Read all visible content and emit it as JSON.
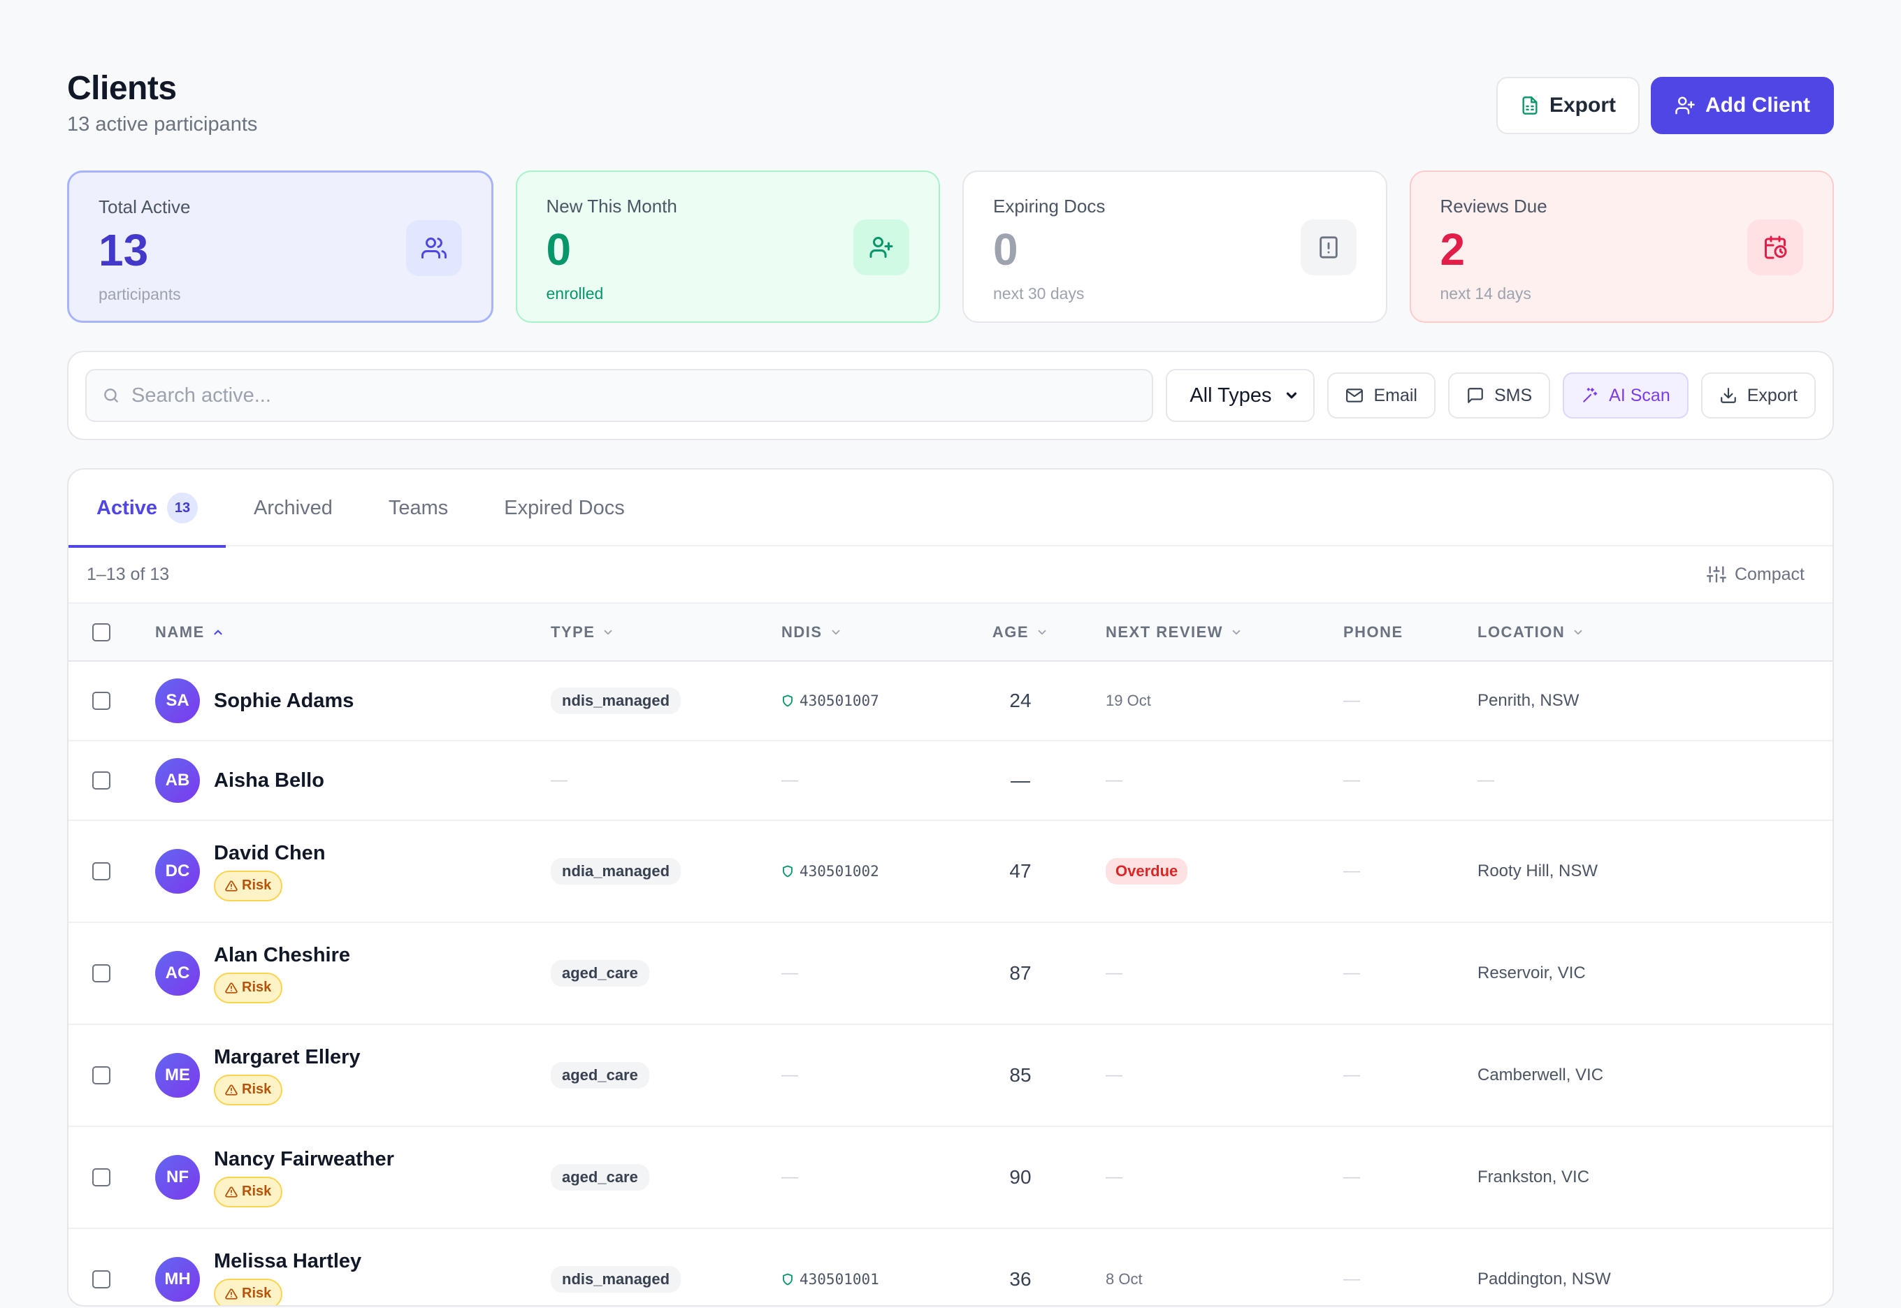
{
  "header": {
    "title": "Clients",
    "subtitle": "13 active participants",
    "export_label": "Export",
    "add_label": "Add Client"
  },
  "stats": [
    {
      "label": "Total Active",
      "value": "13",
      "sub": "participants",
      "icon": "users-icon"
    },
    {
      "label": "New This Month",
      "value": "0",
      "sub": "enrolled",
      "icon": "user-plus-icon"
    },
    {
      "label": "Expiring Docs",
      "value": "0",
      "sub": "next 30 days",
      "icon": "file-alert-icon"
    },
    {
      "label": "Reviews Due",
      "value": "2",
      "sub": "next 14 days",
      "icon": "calendar-clock-icon"
    }
  ],
  "toolbar": {
    "search_placeholder": "Search active...",
    "type_filter": "All Types",
    "email_label": "Email",
    "sms_label": "SMS",
    "ai_label": "AI Scan",
    "export_label": "Export"
  },
  "tabs": [
    {
      "label": "Active",
      "badge": "13"
    },
    {
      "label": "Archived"
    },
    {
      "label": "Teams"
    },
    {
      "label": "Expired Docs"
    }
  ],
  "list_meta": {
    "count": "1–13 of 13",
    "compact_label": "Compact"
  },
  "columns": {
    "name": "NAME",
    "type": "TYPE",
    "ndis": "NDIS",
    "age": "AGE",
    "next_review": "NEXT REVIEW",
    "phone": "PHONE",
    "location": "LOCATION"
  },
  "risk_label": "Risk",
  "rows": [
    {
      "initials": "SA",
      "name": "Sophie Adams",
      "risk": false,
      "type": "ndis_managed",
      "ndis": "430501007",
      "age": "24",
      "review": "19 Oct",
      "review_overdue": false,
      "phone": "—",
      "location": "Penrith, NSW"
    },
    {
      "initials": "AB",
      "name": "Aisha Bello",
      "risk": false,
      "type": "—",
      "ndis": "—",
      "age": "—",
      "review": "—",
      "review_overdue": false,
      "phone": "—",
      "location": "—"
    },
    {
      "initials": "DC",
      "name": "David Chen",
      "risk": true,
      "type": "ndia_managed",
      "ndis": "430501002",
      "age": "47",
      "review": "Overdue",
      "review_overdue": true,
      "phone": "—",
      "location": "Rooty Hill, NSW"
    },
    {
      "initials": "AC",
      "name": "Alan Cheshire",
      "risk": true,
      "type": "aged_care",
      "ndis": "—",
      "age": "87",
      "review": "—",
      "review_overdue": false,
      "phone": "—",
      "location": "Reservoir, VIC"
    },
    {
      "initials": "ME",
      "name": "Margaret Ellery",
      "risk": true,
      "type": "aged_care",
      "ndis": "—",
      "age": "85",
      "review": "—",
      "review_overdue": false,
      "phone": "—",
      "location": "Camberwell, VIC"
    },
    {
      "initials": "NF",
      "name": "Nancy Fairweather",
      "risk": true,
      "type": "aged_care",
      "ndis": "—",
      "age": "90",
      "review": "—",
      "review_overdue": false,
      "phone": "—",
      "location": "Frankston, VIC"
    },
    {
      "initials": "MH",
      "name": "Melissa Hartley",
      "risk": true,
      "type": "ndis_managed",
      "ndis": "430501001",
      "age": "36",
      "review": "8 Oct",
      "review_overdue": false,
      "phone": "—",
      "location": "Paddington, NSW"
    }
  ]
}
